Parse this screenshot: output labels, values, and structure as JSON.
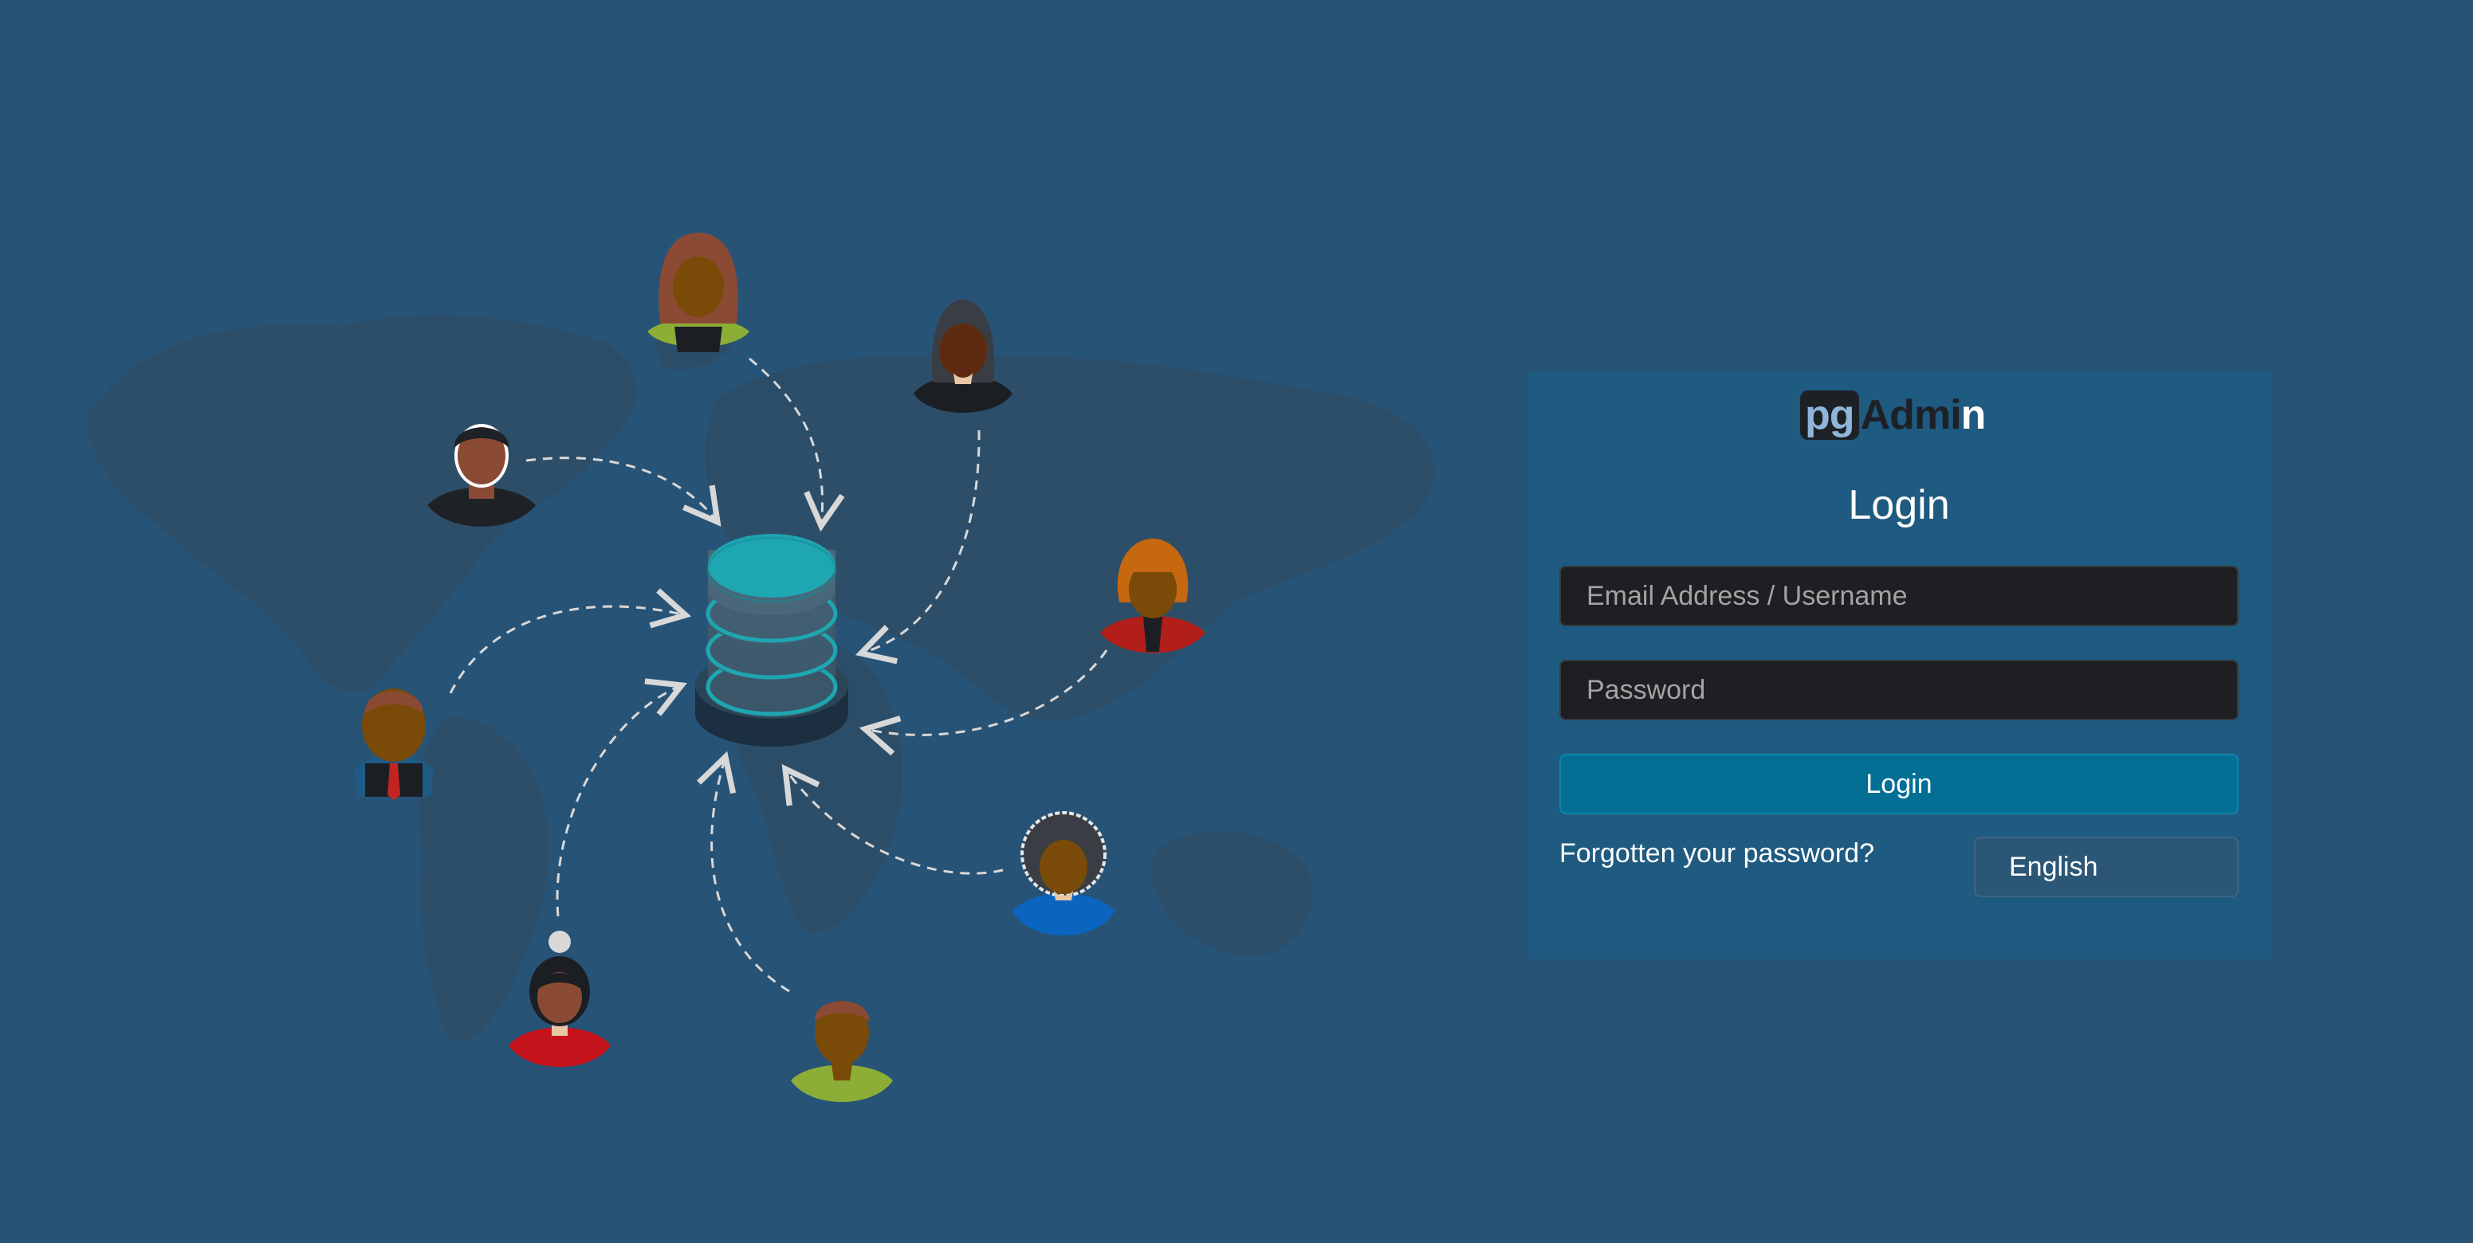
{
  "colors": {
    "background": "#275377",
    "panel": "#1f5a80",
    "primary_button": "#036f95",
    "input_bg": "#1d1f22",
    "db_accent": "#1ea6b1"
  },
  "logo": {
    "part_pg": "pg",
    "part_a": "A",
    "part_dm": "dm",
    "part_i": "i",
    "part_n": "n"
  },
  "login": {
    "title": "Login",
    "email_placeholder": "Email Address / Username",
    "email_value": "",
    "password_placeholder": "Password",
    "password_value": "",
    "submit_label": "Login",
    "forgot_link": "Forgotten your password?",
    "language": "English"
  },
  "illustration": {
    "center_icon": "database-icon",
    "avatars": [
      "avatar-woman-long-hair",
      "avatar-woman-hijab",
      "avatar-man-beard",
      "avatar-woman-orange-hair",
      "avatar-man-tie",
      "avatar-man-afro",
      "avatar-woman-bun",
      "avatar-man-green-shirt"
    ]
  }
}
